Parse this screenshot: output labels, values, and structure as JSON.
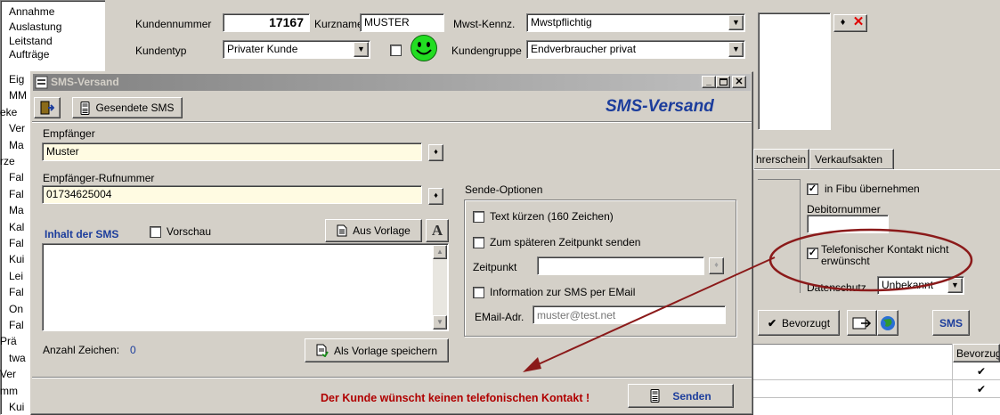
{
  "sidebar": {
    "items": [
      "Annahme",
      "Auslastung",
      "Leitstand",
      "Aufträge",
      "Eig",
      "MM",
      "eke",
      "Ver",
      "Ma",
      "rze",
      "Fal",
      "Fal",
      "Ma",
      "Kal",
      "Fal",
      "Kui",
      "Lei",
      "Fal",
      "On",
      "Fal",
      "Prä",
      "twa",
      "Ver",
      "mm",
      "Kui"
    ]
  },
  "main": {
    "kundennummer_label": "Kundennummer",
    "kundennummer_value": "17167",
    "kurzname_label": "Kurzname",
    "kurzname_value": "MUSTER",
    "mwst_label": "Mwst-Kennz.",
    "mwst_value": "Mwstpflichtig",
    "kundentyp_label": "Kundentyp",
    "kundentyp_value": "Privater Kunde",
    "kundengruppe_label": "Kundengruppe",
    "kundengruppe_value": "Endverbraucher privat"
  },
  "right_panel": {
    "tabs": [
      "hrerschein",
      "Verkaufsakten"
    ],
    "fibu_label": "in Fibu übernehmen",
    "fibu_checked": "✓",
    "debitor_label": "Debitornummer",
    "debitor_value": "",
    "telefon_label_1": "Telefonischer Kontakt nicht",
    "telefon_label_2": "erwünscht",
    "telefon_checked": "✓",
    "datenschutz_label": "Datenschutz",
    "datenschutz_value": "Unbekannt",
    "bevorzugt_label": "Bevorzugt",
    "sms_label": "SMS",
    "grid_header": "Bevorzug",
    "grid_checks": [
      "✔",
      "✔"
    ]
  },
  "dialog": {
    "title": "SMS-Versand",
    "heading": "SMS-Versand",
    "gesendete_label": "Gesendete SMS",
    "empfaenger_label": "Empfänger",
    "empfaenger_value": "Muster",
    "rufnummer_label": "Empfänger-Rufnummer",
    "rufnummer_value": "01734625004",
    "inhalt_label": "Inhalt der SMS",
    "vorschau_label": "Vorschau",
    "aus_vorlage_label": "Aus Vorlage",
    "anzahl_label": "Anzahl Zeichen:",
    "anzahl_value": "0",
    "als_vorlage_label": "Als Vorlage speichern",
    "sende_optionen_label": "Sende-Optionen",
    "text_kuerzen_label": "Text kürzen (160 Zeichen)",
    "spaeter_label": "Zum späteren Zeitpunkt senden",
    "zeitpunkt_label": "Zeitpunkt",
    "information_label": "Information zur SMS per EMail",
    "email_label": "EMail-Adr.",
    "email_placeholder": "muster@test.net",
    "warning": "Der Kunde wünscht keinen telefonischen Kontakt !",
    "senden_label": "Senden"
  },
  "colors": {
    "title_bar_start": "#808080",
    "title_bar_end": "#c0c0c0",
    "heading_blue": "#1c3d9c",
    "warning_red": "#b00000",
    "annotation_red": "#8b1a1a",
    "yellow_field": "#fffbe2",
    "smiley": "#22dd22"
  }
}
